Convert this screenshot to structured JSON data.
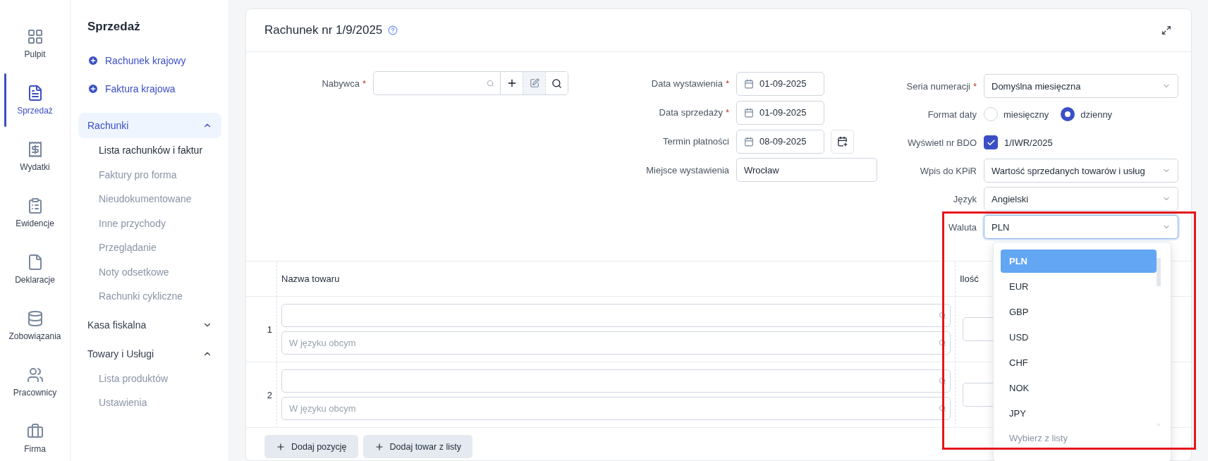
{
  "rail": [
    {
      "label": "Pulpit",
      "selected": false
    },
    {
      "label": "Sprzedaż",
      "selected": true
    },
    {
      "label": "Wydatki",
      "selected": false
    },
    {
      "label": "Ewidencje",
      "selected": false
    },
    {
      "label": "Deklaracje",
      "selected": false
    },
    {
      "label": "Zobowiązania",
      "selected": false
    },
    {
      "label": "Pracownicy",
      "selected": false
    },
    {
      "label": "Firma",
      "selected": false
    }
  ],
  "sidebar": {
    "title": "Sprzedaż",
    "quick_actions": [
      "Rachunek krajowy",
      "Faktura krajowa"
    ],
    "groups": [
      {
        "label": "Rachunki",
        "expanded": true,
        "selected": true,
        "children": [
          {
            "label": "Lista rachunków i faktur",
            "selected": true
          },
          {
            "label": "Faktury pro forma",
            "selected": false
          },
          {
            "label": "Nieudokumentowane",
            "selected": false
          },
          {
            "label": "Inne przychody",
            "selected": false
          },
          {
            "label": "Przeglądanie",
            "selected": false
          },
          {
            "label": "Noty odsetkowe",
            "selected": false
          },
          {
            "label": "Rachunki cykliczne",
            "selected": false
          }
        ]
      },
      {
        "label": "Kasa fiskalna",
        "expanded": false,
        "selected": false
      },
      {
        "label": "Towary i Usługi",
        "expanded": true,
        "selected": false,
        "children": [
          {
            "label": "Lista produktów",
            "selected": false
          },
          {
            "label": "Ustawienia",
            "selected": false
          }
        ]
      }
    ]
  },
  "document": {
    "title": "Rachunek nr 1/9/2025"
  },
  "required_mark": "*",
  "buyer": {
    "label": "Nabywca",
    "required": true
  },
  "dates": [
    {
      "kind": "date",
      "label": "Data wystawienia",
      "required": true,
      "value": "01-09-2025"
    },
    {
      "kind": "date",
      "label": "Data sprzedaży",
      "required": true,
      "value": "01-09-2025"
    },
    {
      "kind": "date_button",
      "label": "Termin płatności",
      "required": false,
      "value": "08-09-2025"
    },
    {
      "kind": "text",
      "label": "Miejsce wystawienia",
      "required": false,
      "value": "Wrocław"
    }
  ],
  "settings": [
    {
      "kind": "select",
      "label": "Seria numeracji",
      "required": true,
      "value": "Domyślna miesięczna",
      "open": false
    },
    {
      "kind": "radio",
      "label": "Format daty",
      "required": false,
      "options": [
        {
          "label": "miesięczny",
          "selected": false
        },
        {
          "label": "dzienny",
          "selected": true
        }
      ]
    },
    {
      "kind": "checkbox",
      "label": "Wyświetl nr BDO",
      "required": false,
      "checked": true,
      "text": "1/IWR/2025"
    },
    {
      "kind": "select",
      "label": "Wpis do KPiR",
      "required": false,
      "value": "Wartość sprzedanych towarów i usług",
      "open": false
    },
    {
      "kind": "select",
      "label": "Język",
      "required": false,
      "value": "Angielski",
      "open": false
    },
    {
      "kind": "select",
      "label": "Waluta",
      "required": false,
      "value": "PLN",
      "open": true
    }
  ],
  "table": {
    "columns": [
      "Nazwa towaru",
      "Ilość"
    ],
    "rows": [
      {
        "number": "1",
        "foreign_placeholder": "W języku obcym"
      },
      {
        "number": "2",
        "foreign_placeholder": "W języku obcym"
      }
    ]
  },
  "buttons": [
    "Dodaj pozycję",
    "Dodaj towar z listy"
  ],
  "currency_dropdown": {
    "highlighted": true,
    "options": [
      {
        "label": "PLN",
        "selected": true
      },
      {
        "label": "EUR",
        "selected": false
      },
      {
        "label": "GBP",
        "selected": false
      },
      {
        "label": "USD",
        "selected": false
      },
      {
        "label": "CHF",
        "selected": false
      },
      {
        "label": "NOK",
        "selected": false
      },
      {
        "label": "JPY",
        "selected": false
      }
    ],
    "footer": "Wybierz z listy"
  }
}
